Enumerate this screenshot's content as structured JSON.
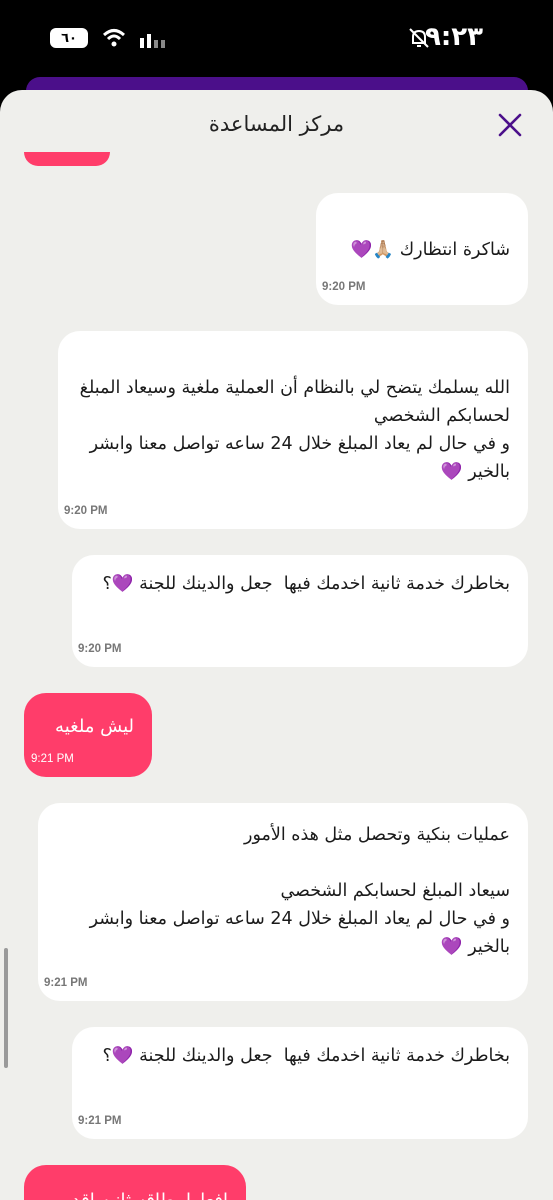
{
  "status_bar": {
    "time": "٩:٢٣",
    "battery": "٦٠",
    "mute_icon": "bell-off-icon",
    "wifi_icon": "wifi-icon",
    "signal_icon": "signal-icon"
  },
  "header": {
    "title": "مركز المساعدة",
    "close_icon": "close-icon"
  },
  "colors": {
    "agent_bubble": "#ffffff",
    "user_bubble": "#ff3d6a",
    "accent_purple": "#4b0f8a",
    "sheet_bg": "#efefec"
  },
  "messages": [
    {
      "sender": "agent",
      "text": "شاكرة انتظارك 🙏🏼💜",
      "time": "9:20 PM"
    },
    {
      "sender": "agent",
      "text": "الله يسلمك يتضح لي بالنظام أن العملية ملغية وسيعاد المبلغ لحسابكم الشخصي\nو في حال لم يعاد المبلغ خلال 24 ساعه تواصل معنا وابشر بالخير 💜",
      "time": "9:20 PM"
    },
    {
      "sender": "agent",
      "text": "بخاطرك خدمة ثانية اخدمك فيها  جعل والدينك للجنة 💜؟",
      "time": "9:20 PM"
    },
    {
      "sender": "user",
      "text": "ليش ملغيه",
      "time": "9:21 PM"
    },
    {
      "sender": "agent",
      "text": "عمليات بنكية وتحصل مثل هذه الأمور\n\nسيعاد المبلغ لحسابكم الشخصي\nو في حال لم يعاد المبلغ خلال 24 ساعه تواصل معنا وابشر بالخير 💜",
      "time": "9:21 PM"
    },
    {
      "sender": "agent",
      "text": "بخاطرك خدمة ثانية اخدمك فيها  جعل والدينك للجنة 💜؟",
      "time": "9:21 PM"
    },
    {
      "sender": "user",
      "text": "افعلها بطاقه ثانيه اقدر",
      "time": ""
    }
  ]
}
